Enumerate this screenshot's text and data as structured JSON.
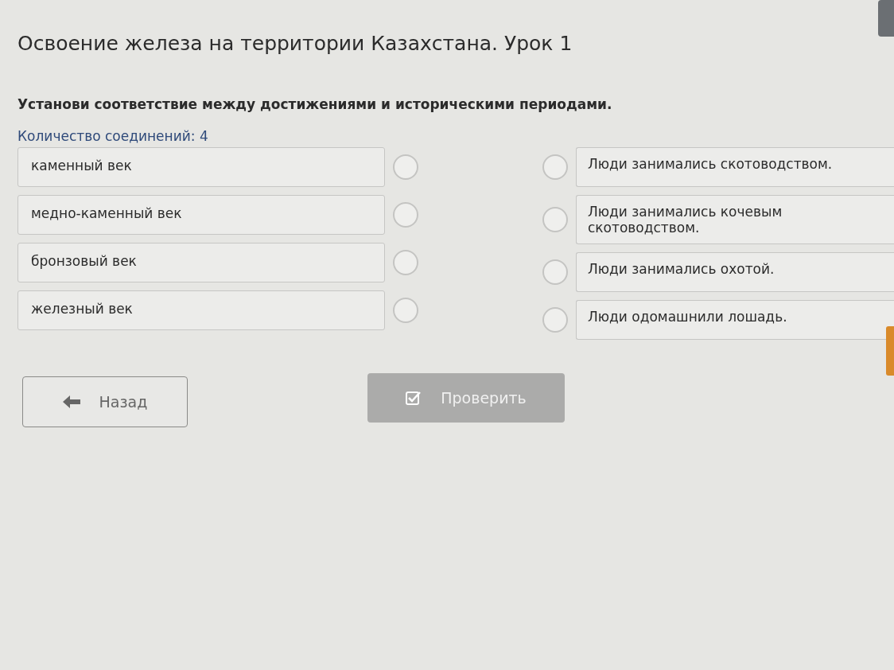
{
  "title": "Освоение железа на территории Казахстана. Урок 1",
  "question": "Установи соответствие между достижениями и историческими периодами.",
  "connection_count": "Количество соединений: 4",
  "left_items": [
    {
      "label": "каменный век"
    },
    {
      "label": "медно-каменный век"
    },
    {
      "label": "бронзовый век"
    },
    {
      "label": "железный век"
    }
  ],
  "right_items": [
    {
      "label": "Люди занимались скотоводством."
    },
    {
      "label": "Люди занимались кочевым скотоводством."
    },
    {
      "label": "Люди занимались охотой."
    },
    {
      "label": "Люди одомашнили лошадь."
    }
  ],
  "buttons": {
    "back": {
      "label": "Назад"
    },
    "check": {
      "label": "Проверить",
      "disabled": true
    }
  }
}
